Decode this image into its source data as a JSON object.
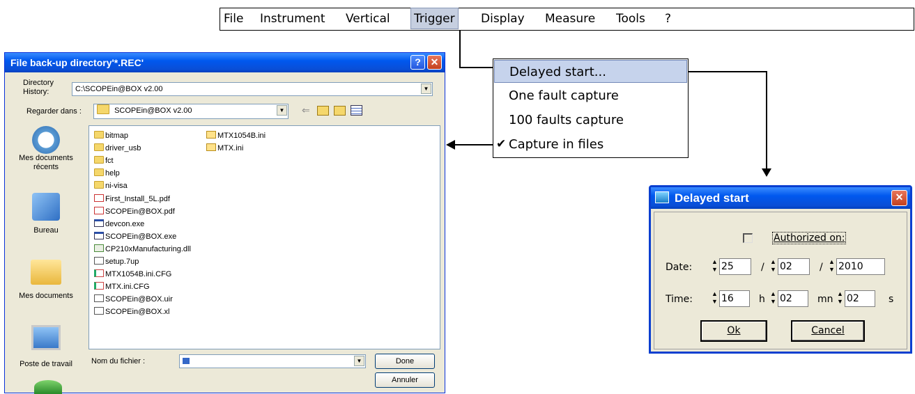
{
  "menubar": {
    "items": [
      "File",
      "Instrument",
      "Vertical",
      "Trigger",
      "Display",
      "Measure",
      "Tools",
      "?"
    ],
    "selected": "Trigger"
  },
  "trigger_menu": {
    "items": [
      "Delayed start...",
      "One fault capture",
      "100 faults capture",
      "Capture in files"
    ],
    "highlighted": "Delayed start...",
    "checked": "Capture in files"
  },
  "file_dialog": {
    "title": "File back-up directory'*.REC'",
    "directory_history_label_1": "Directory",
    "directory_history_label_2": "History:",
    "directory_history_value": "C:\\SCOPEin@BOX v2.00",
    "look_in_label": "Regarder dans :",
    "look_in_value": "SCOPEin@BOX v2.00",
    "places": [
      {
        "label1": "Mes documents",
        "label2": "récents"
      },
      {
        "label1": "Bureau",
        "label2": ""
      },
      {
        "label1": "Mes documents",
        "label2": ""
      },
      {
        "label1": "Poste de travail",
        "label2": ""
      }
    ],
    "files_col1": [
      {
        "name": "bitmap",
        "type": "folder"
      },
      {
        "name": "driver_usb",
        "type": "folder"
      },
      {
        "name": "fct",
        "type": "folder"
      },
      {
        "name": "help",
        "type": "folder"
      },
      {
        "name": "ni-visa",
        "type": "folder"
      },
      {
        "name": "First_Install_5L.pdf",
        "type": "pdf"
      },
      {
        "name": "SCOPEin@BOX.pdf",
        "type": "pdf"
      },
      {
        "name": "devcon.exe",
        "type": "exe"
      },
      {
        "name": "SCOPEin@BOX.exe",
        "type": "exe"
      },
      {
        "name": "CP210xManufacturing.dll",
        "type": "dll"
      },
      {
        "name": "setup.7up",
        "type": "txt"
      },
      {
        "name": "MTX1054B.ini.CFG",
        "type": "cfg"
      },
      {
        "name": "MTX.ini.CFG",
        "type": "cfg"
      },
      {
        "name": "SCOPEin@BOX.uir",
        "type": "txt"
      },
      {
        "name": "SCOPEin@BOX.xl",
        "type": "txt"
      }
    ],
    "files_col2": [
      {
        "name": "MTX1054B.ini",
        "type": "ini"
      },
      {
        "name": "MTX.ini",
        "type": "ini"
      }
    ],
    "filename_label": "Nom du fichier :",
    "filename_value": "",
    "done_label": "Done",
    "cancel_label": "Annuler",
    "help_glyph": "?",
    "close_glyph": "✕"
  },
  "delayed_dialog": {
    "title": "Delayed start",
    "close_glyph": "✕",
    "authorized_label": "Authorized on:",
    "authorized_checked": false,
    "date_label": "Date:",
    "date_day": "25",
    "date_month": "02",
    "date_year": "2010",
    "date_sep": "/",
    "time_label": "Time:",
    "time_h": "16",
    "time_h_unit": "h",
    "time_mn": "02",
    "time_mn_unit": "mn",
    "time_s": "02",
    "time_s_unit": "s",
    "ok_label": "Ok",
    "cancel_label": "Cancel"
  },
  "colors": {
    "xp_title": "#0058ee",
    "menu_selected": "#c6cfe0",
    "dropdown_highlight": "#c6d3ec"
  }
}
